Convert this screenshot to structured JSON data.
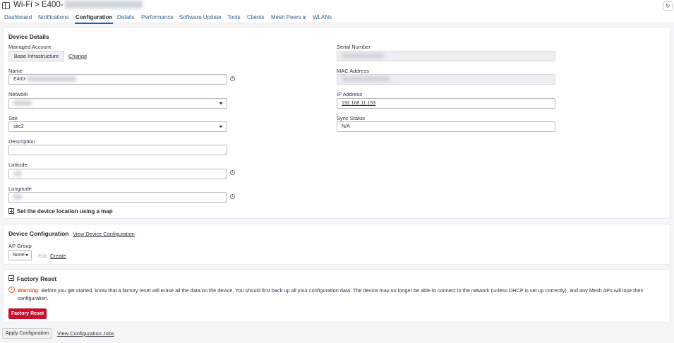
{
  "header": {
    "title": "Wi-Fi > E400-",
    "refresh_icon": "refresh-icon"
  },
  "tabs": [
    {
      "label": "Dashboard"
    },
    {
      "label": "Notifications"
    },
    {
      "label": "Configuration",
      "active": true
    },
    {
      "label": "Details"
    },
    {
      "label": "Performance"
    },
    {
      "label": "Software Update"
    },
    {
      "label": "Tools"
    },
    {
      "label": "Clients"
    },
    {
      "label": "Mesh Peers",
      "badge": "x"
    },
    {
      "label": "WLANs"
    }
  ],
  "device_details": {
    "title": "Device Details",
    "managed_account_label": "Managed Account",
    "managed_account_value": "Base Infrastructure",
    "change_link": "Change",
    "name_label": "Name",
    "name_value": "E400-",
    "network_label": "Network",
    "site_label": "Site",
    "site_value": "site2",
    "description_label": "Description",
    "latitude_label": "Latitude",
    "longitude_label": "Longitude",
    "map_link": "Set the device location using a map",
    "serial_label": "Serial Number",
    "mac_label": "MAC Address",
    "ip_label": "IP Address",
    "ip_value": "192.168.11.153",
    "sync_label": "Sync Status",
    "sync_value": "N/A"
  },
  "device_configuration": {
    "title": "Device Configuration",
    "view_link": "View Device Configuration",
    "ap_group_label": "AP Group",
    "ap_group_value": "None",
    "edit_link": "Edit",
    "create_link": "Create"
  },
  "factory_reset": {
    "title": "Factory Reset",
    "warning_prefix": "Warning:",
    "warning_text": "Before you get started, know that a factory reset will erase all the data on the device. You should first back up all your configuration data. The device may no longer be able to connect to the network (unless DHCP is set up correctly), and any Mesh APs will lose their configuration.",
    "button": "Factory Reset",
    "accent_color": "#c8102e"
  },
  "footer": {
    "apply_button": "Apply Configuration",
    "jobs_link": "View Configuration Jobs"
  }
}
